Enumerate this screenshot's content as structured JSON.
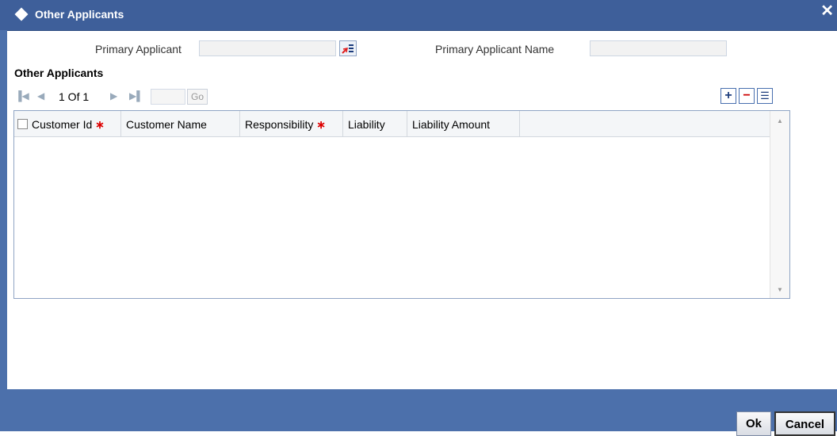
{
  "window": {
    "title": "Other Applicants",
    "close_label": "✕"
  },
  "form": {
    "primary_applicant_label": "Primary Applicant",
    "primary_applicant_value": "",
    "primary_applicant_name_label": "Primary Applicant Name",
    "primary_applicant_name_value": ""
  },
  "section": {
    "title": "Other Applicants"
  },
  "pager": {
    "first_icon": "first-page-icon",
    "prev_icon": "previous-page-icon",
    "next_icon": "next-page-icon",
    "last_icon": "last-page-icon",
    "page_info": "1 Of 1",
    "page_input": "",
    "go_label": "Go"
  },
  "grid_actions": {
    "add_label": "+",
    "delete_label": "−",
    "single_view_label": "☰"
  },
  "table": {
    "columns": [
      {
        "label": "Customer Id",
        "required": true
      },
      {
        "label": "Customer Name",
        "required": false
      },
      {
        "label": "Responsibility",
        "required": true
      },
      {
        "label": "Liability",
        "required": false
      },
      {
        "label": "Liability Amount",
        "required": false
      }
    ],
    "required_marker": "∗",
    "rows": []
  },
  "footer": {
    "ok_label": "Ok",
    "cancel_label": "Cancel"
  },
  "colors": {
    "titlebar": "#3e5f9a",
    "footer": "#4c70ab",
    "required": "#dd0000"
  }
}
